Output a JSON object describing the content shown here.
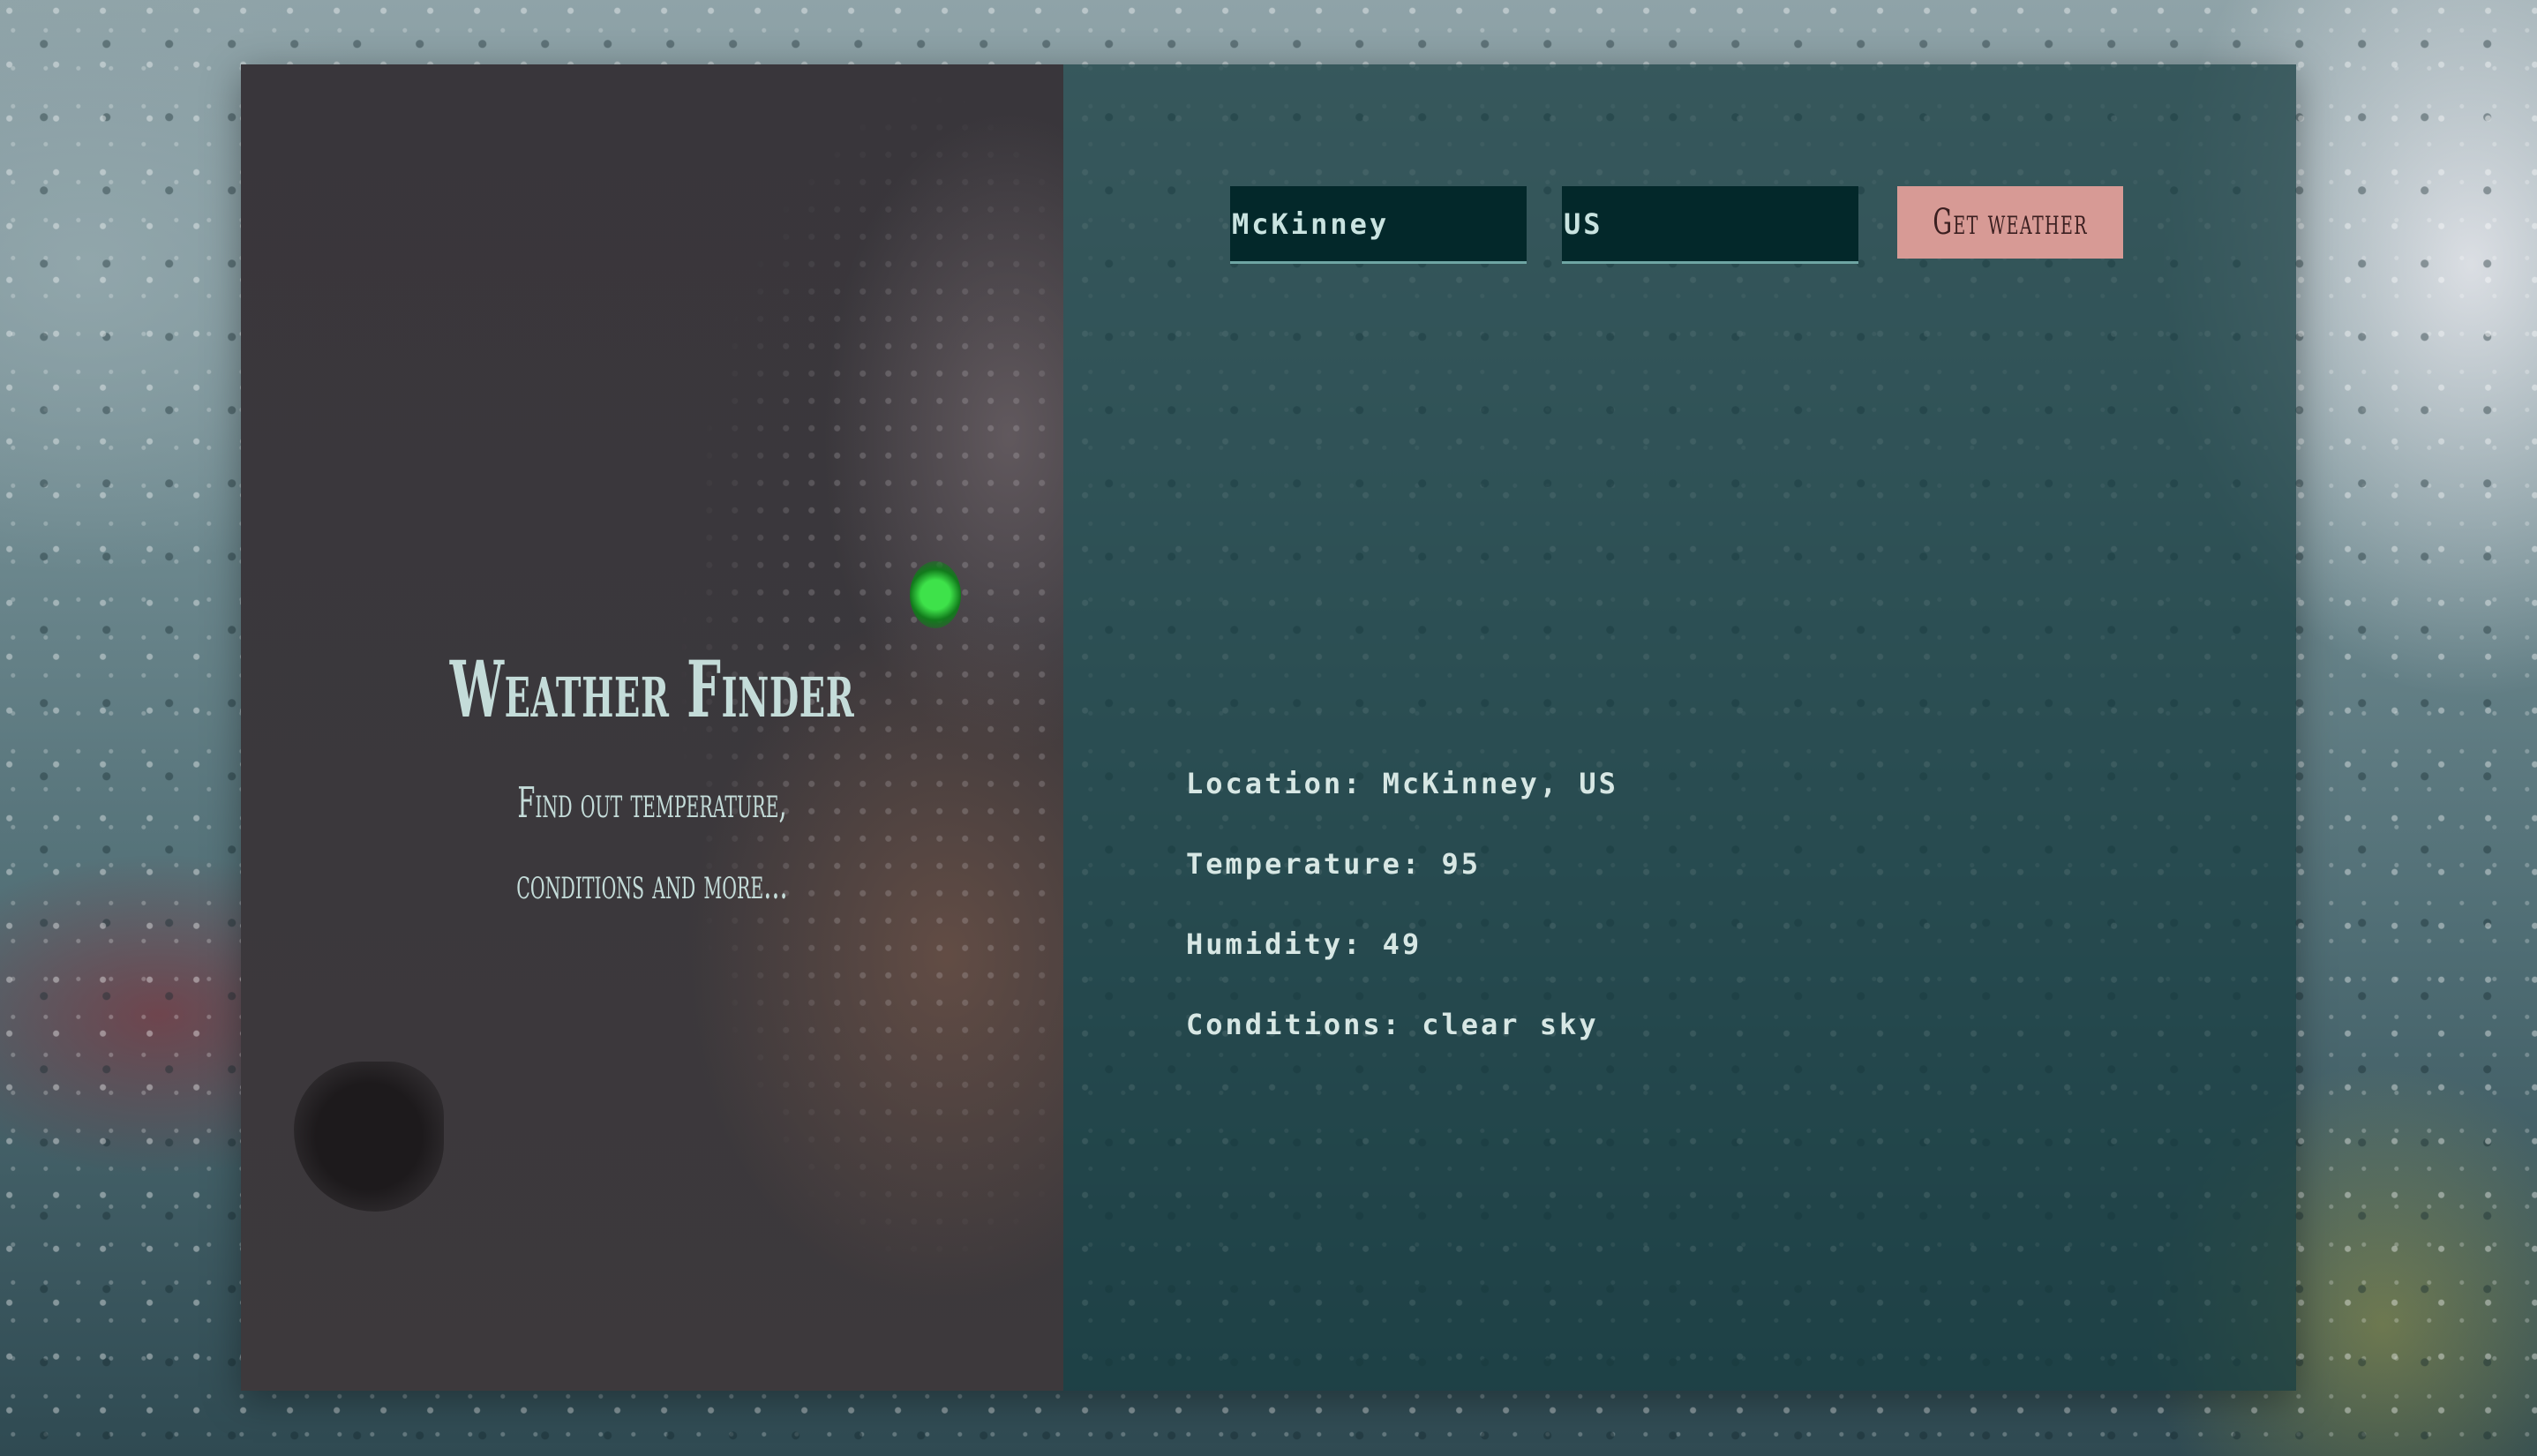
{
  "brand": {
    "title": "Weather Finder",
    "subtitle": "Find out temperature, conditions and more..."
  },
  "form": {
    "city_value": "McKinney",
    "country_value": "US",
    "submit_label": "Get weather"
  },
  "results": {
    "location": "Location: McKinney, US",
    "temperature": "Temperature: 95",
    "humidity": "Humidity: 49",
    "conditions": "Conditions: clear sky"
  },
  "colors": {
    "accent_button": "#d79a95",
    "text_light": "#c4dcd9",
    "input_bg": "#03282a",
    "right_panel": "#163c40",
    "left_panel": "#39363b"
  },
  "icons": {
    "background": "rain-window-photo",
    "left_image": "snow-wolf-photo"
  }
}
